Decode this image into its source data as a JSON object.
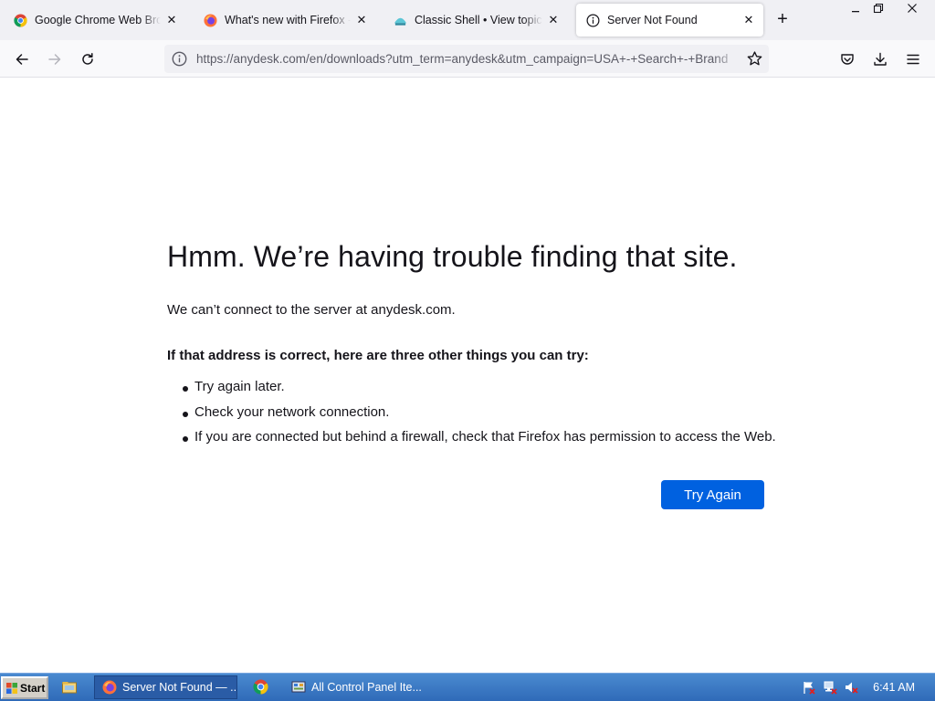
{
  "tabs": [
    {
      "title": "Google Chrome Web Browser",
      "icon": "chrome-icon",
      "active": false
    },
    {
      "title": "What's new with Firefox - Mozilla",
      "icon": "firefox-icon",
      "active": false
    },
    {
      "title": "Classic Shell • View topic - Wi",
      "icon": "classic-shell-icon",
      "active": false
    },
    {
      "title": "Server Not Found",
      "icon": "info-icon",
      "active": true
    }
  ],
  "navbar": {
    "url": "https://anydesk.com/en/downloads?utm_term=anydesk&utm_campaign=USA+-+Search+-+Brand"
  },
  "error": {
    "title": "Hmm. We’re having trouble finding that site.",
    "description": "We can’t connect to the server at anydesk.com.",
    "hint": "If that address is correct, here are three other things you can try:",
    "suggestions": [
      "Try again later.",
      "Check your network connection.",
      "If you are connected but behind a firewall, check that Firefox has permission to access the Web."
    ],
    "button_label": "Try Again"
  },
  "taskbar": {
    "start_label": "Start",
    "tasks": [
      {
        "label": "Server Not Found — ...",
        "icon": "firefox-icon",
        "active": true
      },
      {
        "label": "All Control Panel Ite...",
        "icon": "control-panel-icon",
        "active": false
      }
    ],
    "clock": "6:41 AM"
  },
  "colors": {
    "accent_button": "#0061e0",
    "taskbar": "#3a78c4",
    "tabstrip": "#f0f0f4"
  }
}
